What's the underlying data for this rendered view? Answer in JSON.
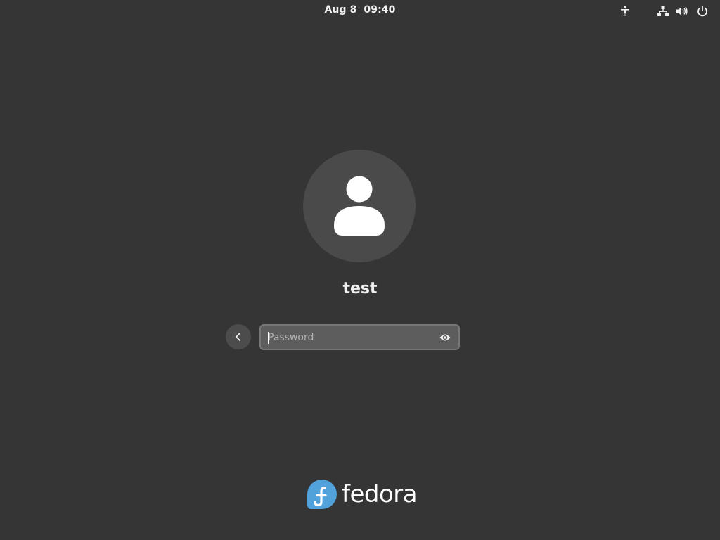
{
  "topbar": {
    "date": "Aug 8",
    "time": "09:40",
    "icons": [
      "accessibility-icon",
      "network-icon",
      "volume-icon",
      "power-icon"
    ]
  },
  "login": {
    "username": "test",
    "password_placeholder": "Password",
    "password_value": ""
  },
  "branding": {
    "logo_text": "fedora",
    "logo_color": "#51a2da"
  },
  "colors": {
    "background": "#353535",
    "avatar_bg": "#4a4a4a",
    "input_bg": "#5d5d5d"
  }
}
